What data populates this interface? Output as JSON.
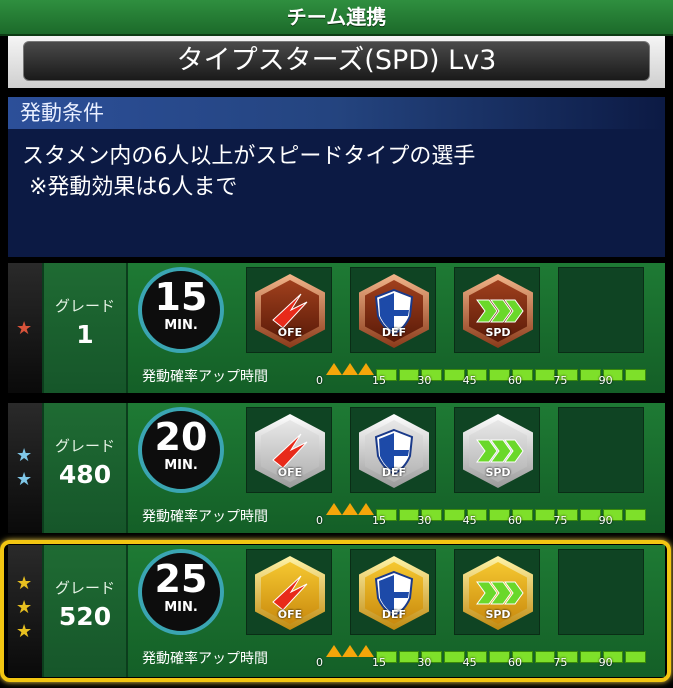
{
  "header": {
    "title": "チーム連携"
  },
  "team": {
    "name": "タイプスターズ(SPD) Lv3"
  },
  "condition": {
    "heading": "発動条件",
    "text": "スタメン内の6人以上がスピードタイプの選手\n ※発動効果は6人まで"
  },
  "grades": [
    {
      "label": "グレード",
      "value": "1",
      "minutes": "15",
      "unit": "MIN.",
      "tier": "bronze",
      "stars": 1,
      "star_color": "#d9533a",
      "abilities": [
        "OFE",
        "DEF",
        "SPD"
      ],
      "bar_label": "発動確率アップ時間",
      "level_min": 15
    },
    {
      "label": "グレード",
      "value": "480",
      "minutes": "20",
      "unit": "MIN.",
      "tier": "silver",
      "stars": 2,
      "star_color": "#7fc7e8",
      "abilities": [
        "OFE",
        "DEF",
        "SPD"
      ],
      "bar_label": "発動確率アップ時間",
      "level_min": 20
    },
    {
      "label": "グレード",
      "value": "520",
      "minutes": "25",
      "unit": "MIN.",
      "tier": "gold",
      "stars": 3,
      "star_color": "#e8c020",
      "abilities": [
        "OFE",
        "DEF",
        "SPD"
      ],
      "bar_label": "発動確率アップ時間",
      "level_min": 25
    }
  ],
  "ticks": [
    "0",
    "15",
    "30",
    "45",
    "60",
    "75",
    "90"
  ],
  "colors": {
    "accent_green": "#1e7a34",
    "highlight": "#f2c612",
    "condition_bg": "#0c1a44"
  }
}
